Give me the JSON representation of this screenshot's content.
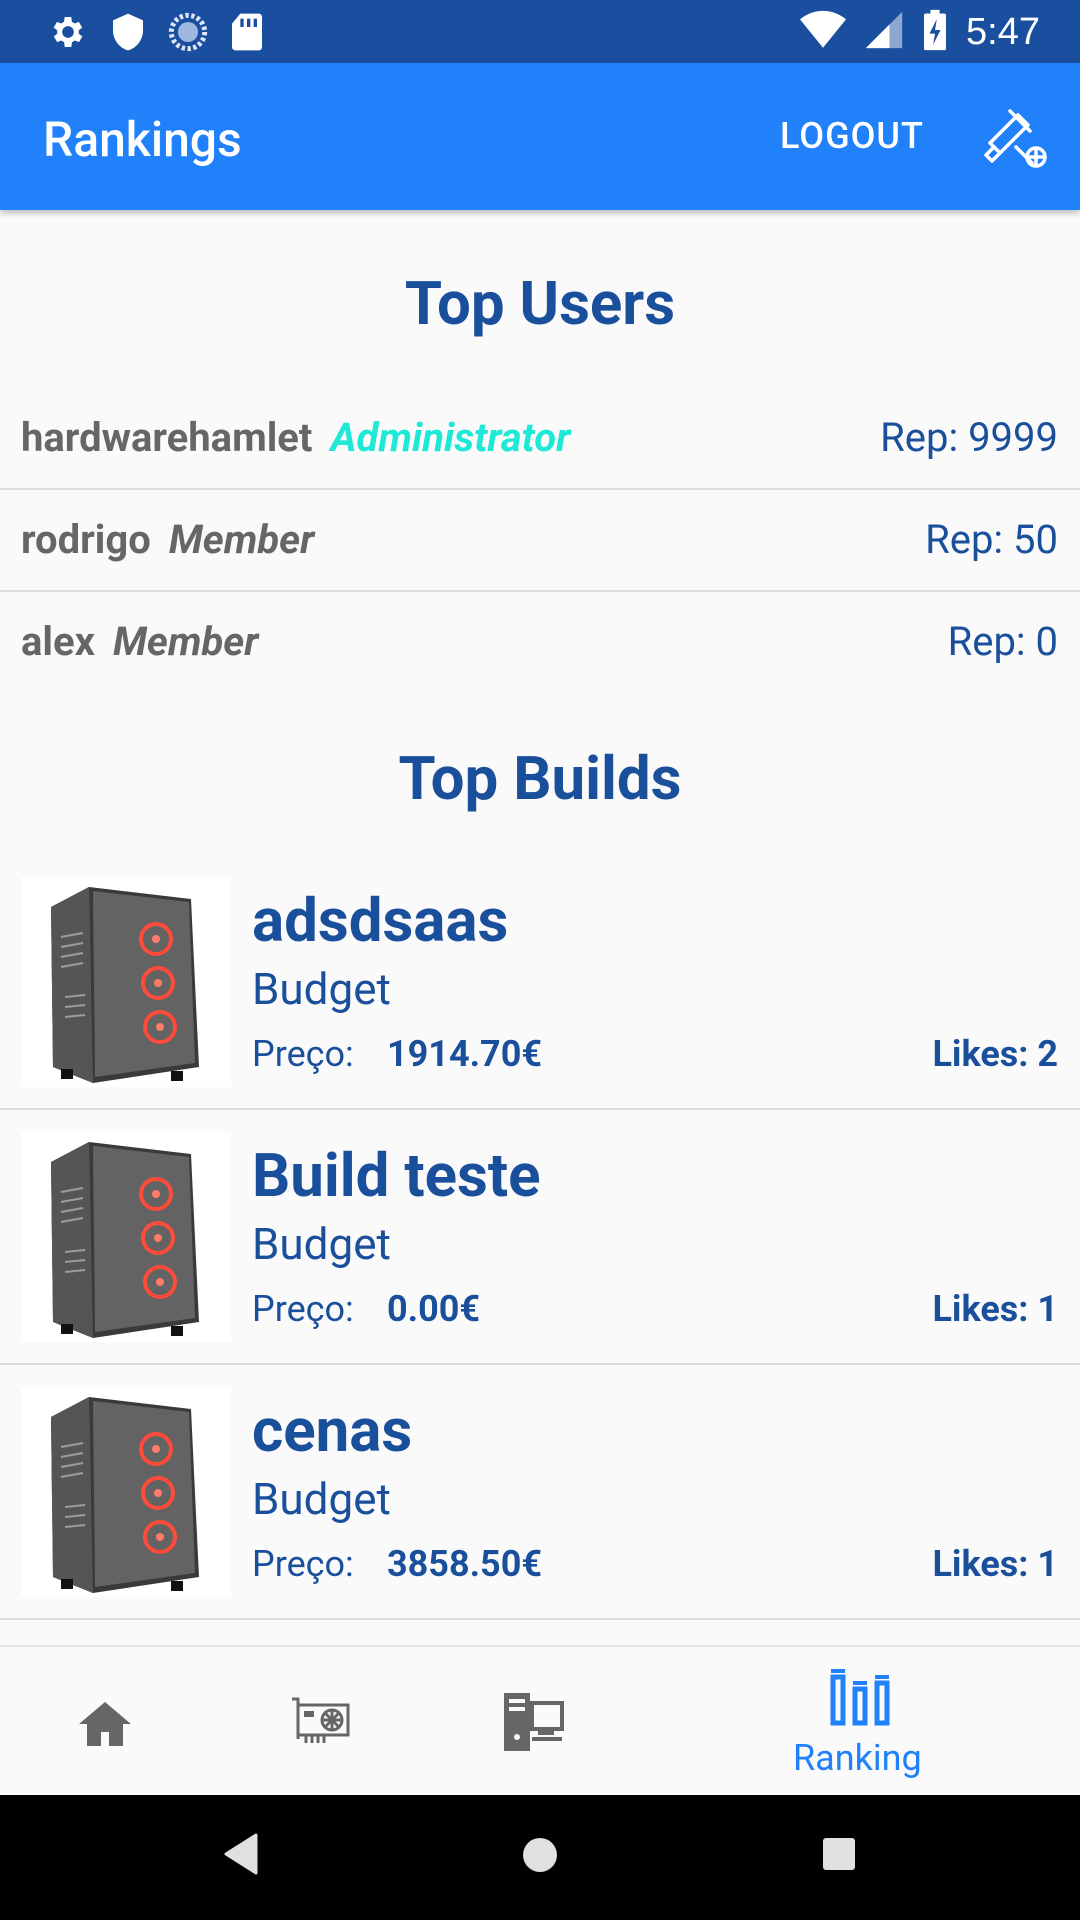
{
  "status_bar": {
    "time": "5:47",
    "icons_left": [
      "gear-icon",
      "shield-icon",
      "sync-icon",
      "sd-card-icon"
    ],
    "icons_right": [
      "wifi-icon",
      "signal-icon",
      "battery-charging-icon"
    ]
  },
  "app_bar": {
    "title": "Rankings",
    "logout_label": "LOGOUT",
    "action_icon": "build-tools-add-icon",
    "color": "#2181fb"
  },
  "top_users": {
    "title": "Top Users",
    "users": [
      {
        "name": "hardwarehamlet",
        "role": "Administrator",
        "role_color": "#1de9d6",
        "rep": "Rep: 9999"
      },
      {
        "name": "rodrigo",
        "role": "Member",
        "role_color": "#666666",
        "rep": "Rep: 50"
      },
      {
        "name": "alex",
        "role": "Member",
        "role_color": "#666666",
        "rep": "Rep: 0"
      }
    ]
  },
  "top_builds": {
    "title": "Top Builds",
    "price_label": "Preço:",
    "builds": [
      {
        "name": "adsdsaas",
        "category": "Budget",
        "price": "1914.70€",
        "likes": "Likes: 2"
      },
      {
        "name": "Build teste",
        "category": "Budget",
        "price": "0.00€",
        "likes": "Likes: 1"
      },
      {
        "name": "cenas",
        "category": "Budget",
        "price": "3858.50€",
        "likes": "Likes: 1"
      }
    ]
  },
  "bottom_nav": {
    "items": [
      {
        "icon": "home-icon",
        "label": ""
      },
      {
        "icon": "graphics-card-icon",
        "label": ""
      },
      {
        "icon": "desktop-computer-icon",
        "label": ""
      },
      {
        "icon": "ranking-bars-icon",
        "label": "Ranking",
        "active": true
      }
    ],
    "active_color": "#2181fb",
    "inactive_color": "#666666"
  },
  "system_nav": {
    "buttons": [
      "back-icon",
      "home-circle-icon",
      "recents-icon"
    ]
  }
}
